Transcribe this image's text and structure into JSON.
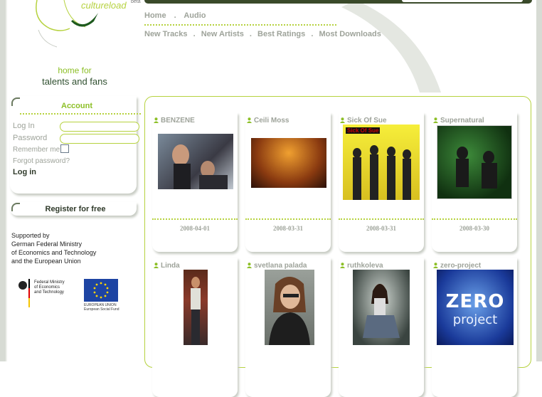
{
  "logo": {
    "name": "cultureload",
    "beta": "beta"
  },
  "tagline": {
    "line1": "home for",
    "line2": "talents and fans"
  },
  "nav_primary": [
    "Home",
    ".",
    "Audio"
  ],
  "nav_secondary": [
    "New Tracks",
    ".",
    "New Artists",
    ".",
    "Best Ratings",
    ".",
    "Most Downloads"
  ],
  "account": {
    "title": "Account",
    "login_label": "Log In",
    "login_value": "",
    "password_label": "Password",
    "password_value": "",
    "remember_label": "Remember me",
    "forgot_label": "Forgot password?",
    "login_button": "Log in"
  },
  "register": {
    "label": "Register for free"
  },
  "support": {
    "line1": "Supported by",
    "line2": "German Federal Ministry",
    "line3": "of Economics and Technology",
    "line4": "and the European Union"
  },
  "sponsors": {
    "bmwi_line1": "Federal Ministry",
    "bmwi_line2": "of Economics",
    "bmwi_line3": "and Technology",
    "eu_line1": "EUROPEAN UNION",
    "eu_line2": "European Social Fund"
  },
  "artists": [
    {
      "name": "BENZENE",
      "date": "2008-04-01"
    },
    {
      "name": "Ceili Moss",
      "date": "2008-03-31"
    },
    {
      "name": "Sick Of Sue",
      "date": "2008-03-31",
      "image_text": "Sick Of Sue"
    },
    {
      "name": "Supernatural",
      "date": "2008-03-30"
    },
    {
      "name": "Linda",
      "date": ""
    },
    {
      "name": "svetlana palada",
      "date": ""
    },
    {
      "name": "ruthkoleva",
      "date": ""
    },
    {
      "name": "zero-project",
      "date": "",
      "image_line1": "ZERO",
      "image_line2": "project"
    }
  ],
  "colors": {
    "accent": "#b6d23f",
    "accent_text": "#8cbf26",
    "nav_text": "#9ea39a",
    "dark": "#2f3a2a"
  },
  "icons": {
    "artist": "user-icon"
  }
}
